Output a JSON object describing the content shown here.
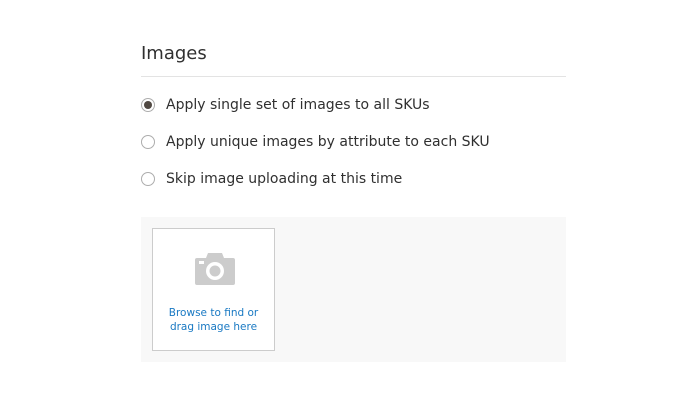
{
  "section": {
    "title": "Images"
  },
  "options": [
    {
      "label": "Apply single set of images to all SKUs",
      "checked": true
    },
    {
      "label": "Apply unique images by attribute to each SKU",
      "checked": false
    },
    {
      "label": "Skip image uploading at this time",
      "checked": false
    }
  ],
  "upload": {
    "line1": "Browse to find or",
    "line2": "drag image here",
    "icon": "camera-icon"
  },
  "colors": {
    "link": "#1979c3",
    "radio_checked": "#514943",
    "panel_bg": "#f8f8f8"
  }
}
